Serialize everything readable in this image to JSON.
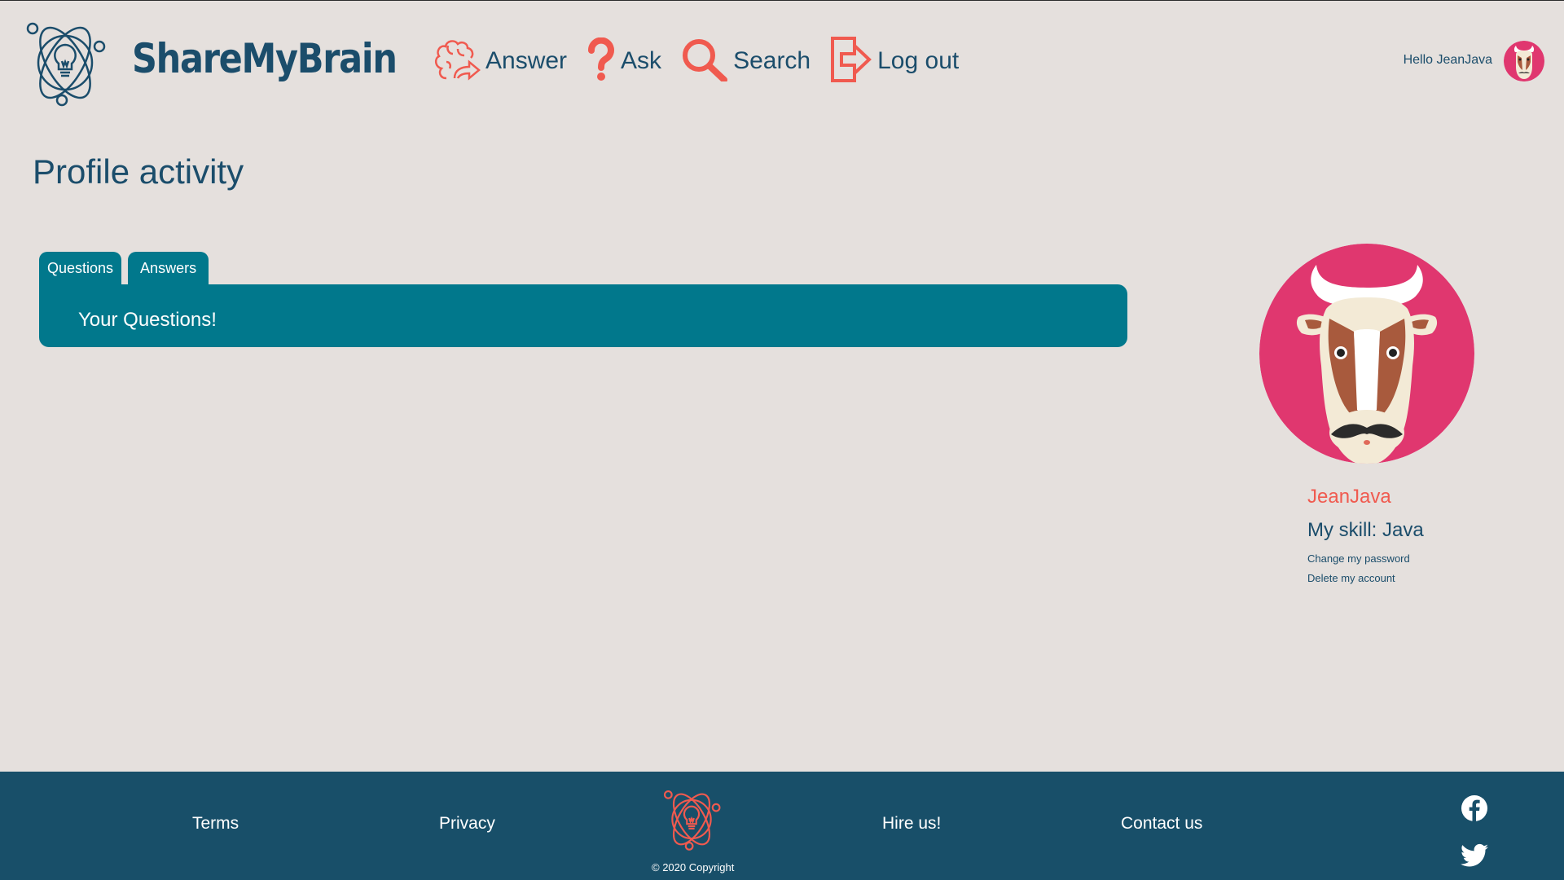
{
  "app": {
    "brand": "ShareMyBrain"
  },
  "nav": {
    "items": [
      {
        "label": "Answer",
        "icon": "brain-share-icon"
      },
      {
        "label": "Ask",
        "icon": "question-mark-icon"
      },
      {
        "label": "Search",
        "icon": "magnifier-icon"
      },
      {
        "label": "Log out",
        "icon": "logout-icon"
      }
    ]
  },
  "user": {
    "greeting": "Hello JeanJava",
    "avatar": "cow-avatar"
  },
  "page": {
    "title": "Profile activity"
  },
  "tabs": [
    {
      "label": "Questions",
      "active": true
    },
    {
      "label": "Answers",
      "active": false
    }
  ],
  "panel": {
    "title": "Your Questions!"
  },
  "profile": {
    "name": "JeanJava",
    "skill": "My skill: Java",
    "links": [
      "Change my password",
      "Delete my account"
    ]
  },
  "footer": {
    "links": [
      "Terms",
      "Privacy",
      "Hire us!",
      "Contact us"
    ],
    "copyright": "© 2020 Copyright",
    "social": [
      "facebook-icon",
      "twitter-icon"
    ]
  },
  "colors": {
    "background": "#e5e0dd",
    "primary_text": "#1b4d6b",
    "accent": "#f05a4f",
    "tab_teal": "#01788c",
    "footer": "#184f69",
    "avatar_pink": "#e0376f"
  }
}
